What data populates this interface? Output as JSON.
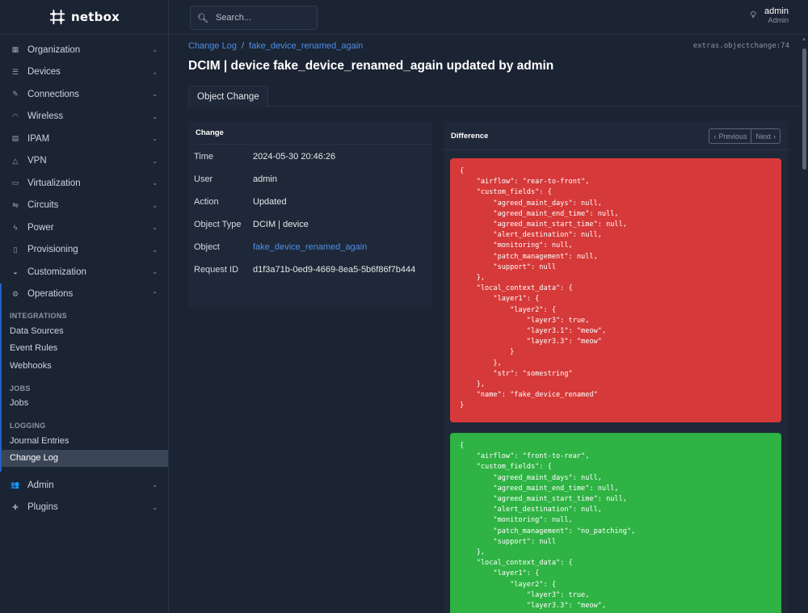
{
  "brand": {
    "name": "netbox"
  },
  "nav": [
    {
      "label": "Organization",
      "icon": "building-icon"
    },
    {
      "label": "Devices",
      "icon": "server-icon"
    },
    {
      "label": "Connections",
      "icon": "plug-icon"
    },
    {
      "label": "Wireless",
      "icon": "wifi-icon"
    },
    {
      "label": "IPAM",
      "icon": "counter-icon"
    },
    {
      "label": "VPN",
      "icon": "tunnel-icon"
    },
    {
      "label": "Virtualization",
      "icon": "monitor-icon"
    },
    {
      "label": "Circuits",
      "icon": "transit-icon"
    },
    {
      "label": "Power",
      "icon": "flash-icon"
    },
    {
      "label": "Provisioning",
      "icon": "file-icon"
    },
    {
      "label": "Customization",
      "icon": "palette-icon"
    },
    {
      "label": "Operations",
      "icon": "cogs-icon"
    }
  ],
  "operations": {
    "sections": [
      {
        "heading": "INTEGRATIONS",
        "items": [
          "Data Sources",
          "Event Rules",
          "Webhooks"
        ]
      },
      {
        "heading": "JOBS",
        "items": [
          "Jobs"
        ]
      },
      {
        "heading": "LOGGING",
        "items": [
          "Journal Entries",
          "Change Log"
        ]
      }
    ],
    "selected": "Change Log"
  },
  "nav_bottom": [
    {
      "label": "Admin",
      "icon": "users-icon"
    },
    {
      "label": "Plugins",
      "icon": "puzzle-icon"
    }
  ],
  "search": {
    "placeholder": "Search..."
  },
  "user": {
    "name": "admin",
    "role": "Admin"
  },
  "breadcrumb": {
    "parent": "Change Log",
    "current": "fake_device_renamed_again"
  },
  "object_ref": "extras.objectchange:74",
  "title": "DCIM | device fake_device_renamed_again updated by admin",
  "tab": "Object Change",
  "change_card": {
    "title": "Change",
    "rows": [
      {
        "key": "Time",
        "value": "2024-05-30 20:46:26"
      },
      {
        "key": "User",
        "value": "admin"
      },
      {
        "key": "Action",
        "value": "Updated"
      },
      {
        "key": "Object Type",
        "value": "DCIM | device"
      },
      {
        "key": "Object",
        "value": "fake_device_renamed_again",
        "link": true
      },
      {
        "key": "Request ID",
        "value": "d1f3a71b-0ed9-4669-8ea5-5b6f86f7b444"
      }
    ]
  },
  "diff_card": {
    "title": "Difference",
    "prev_label": "Previous",
    "next_label": "Next",
    "removed": "{\n    \"airflow\": \"rear-to-front\",\n    \"custom_fields\": {\n        \"agreed_maint_days\": null,\n        \"agreed_maint_end_time\": null,\n        \"agreed_maint_start_time\": null,\n        \"alert_destination\": null,\n        \"monitoring\": null,\n        \"patch_management\": null,\n        \"support\": null\n    },\n    \"local_context_data\": {\n        \"layer1\": {\n            \"layer2\": {\n                \"layer3\": true,\n                \"layer3.1\": \"meow\",\n                \"layer3.3\": \"meow\"\n            }\n        },\n        \"str\": \"somestring\"\n    },\n    \"name\": \"fake_device_renamed\"\n}",
    "added": "{\n    \"airflow\": \"front-to-rear\",\n    \"custom_fields\": {\n        \"agreed_maint_days\": null,\n        \"agreed_maint_end_time\": null,\n        \"agreed_maint_start_time\": null,\n        \"alert_destination\": null,\n        \"monitoring\": null,\n        \"patch_management\": \"no_patching\",\n        \"support\": null\n    },\n    \"local_context_data\": {\n        \"layer1\": {\n            \"layer2\": {\n                \"layer3\": true,\n                \"layer3.3\": \"meow\","
  },
  "colors": {
    "accent": "#1e61c4",
    "link": "#4d8fe8",
    "removed": "#d63939",
    "added": "#2fb344",
    "background": "#1b2433"
  }
}
